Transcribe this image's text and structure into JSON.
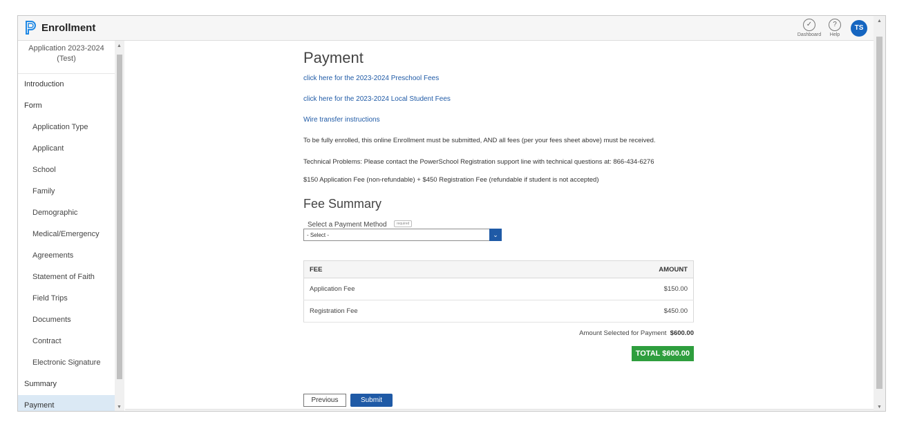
{
  "header": {
    "brand": "Enrollment",
    "dashboard_label": "Dashboard",
    "help_label": "Help",
    "avatar_initials": "TS"
  },
  "sidebar": {
    "application": "Application 2023-2024 (Test)",
    "items": [
      {
        "label": "Introduction"
      },
      {
        "label": "Form"
      },
      {
        "label": "Application Type"
      },
      {
        "label": "Applicant"
      },
      {
        "label": "School"
      },
      {
        "label": "Family"
      },
      {
        "label": "Demographic"
      },
      {
        "label": "Medical/Emergency"
      },
      {
        "label": "Agreements"
      },
      {
        "label": "Statement of Faith"
      },
      {
        "label": "Field Trips"
      },
      {
        "label": "Documents"
      },
      {
        "label": "Contract"
      },
      {
        "label": "Electronic Signature"
      },
      {
        "label": "Summary"
      },
      {
        "label": "Payment"
      }
    ]
  },
  "main": {
    "title": "Payment",
    "links": {
      "preschool": "click here for the 2023-2024 Preschool Fees",
      "local": "click here for the 2023-2024 Local Student Fees",
      "wire": "Wire transfer instructions"
    },
    "notice": "To be fully enrolled, this online Enrollment must be submitted, AND all fees (per your fees sheet above) must be received.",
    "tech": "Technical Problems: Please contact the PowerSchool Registration support line with technical questions at: 866-434-6276",
    "fees_info": "$150 Application Fee (non-refundable) + $450 Registration Fee (refundable if student is not accepted)",
    "fee_summary_title": "Fee Summary",
    "payment_method_label": "Select a Payment Method",
    "required_label": "required",
    "payment_method_value": "- Select -",
    "table": {
      "headers": {
        "fee": "FEE",
        "amount": "AMOUNT"
      },
      "rows": [
        {
          "fee": "Application Fee",
          "amount": "$150.00"
        },
        {
          "fee": "Registration Fee",
          "amount": "$450.00"
        }
      ]
    },
    "amount_selected_label": "Amount Selected for Payment",
    "amount_selected_value": "$600.00",
    "total": "TOTAL $600.00"
  },
  "footer": {
    "previous": "Previous",
    "submit": "Submit"
  },
  "colors": {
    "accent": "#1f5aa6",
    "avatar": "#1565c0",
    "total": "#2e9e3e",
    "active_nav": "#dbe9f5"
  }
}
